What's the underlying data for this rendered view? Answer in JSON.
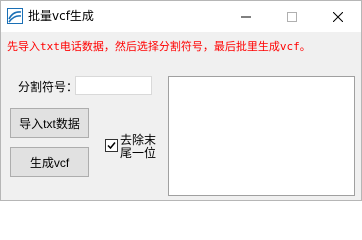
{
  "window": {
    "title": "批量vcf生成"
  },
  "main": {
    "instruction": "先导入txt电话数据，然后选择分割符号，最后批里生成vcf。",
    "delimiter_label": "分割符号：",
    "delimiter_value": "",
    "import_button": "导入txt数据",
    "generate_button": "生成vcf",
    "remove_last_digit_label": "去除末尾一位",
    "remove_last_digit_checked": true,
    "output_text": ""
  },
  "colors": {
    "instruction_text": "#ff0000",
    "window_bg": "#f0f0f0"
  },
  "icons": {
    "app": "app-logo-icon",
    "minimize": "minimize-icon",
    "maximize": "maximize-icon",
    "close": "close-icon",
    "check": "checkmark-icon"
  }
}
